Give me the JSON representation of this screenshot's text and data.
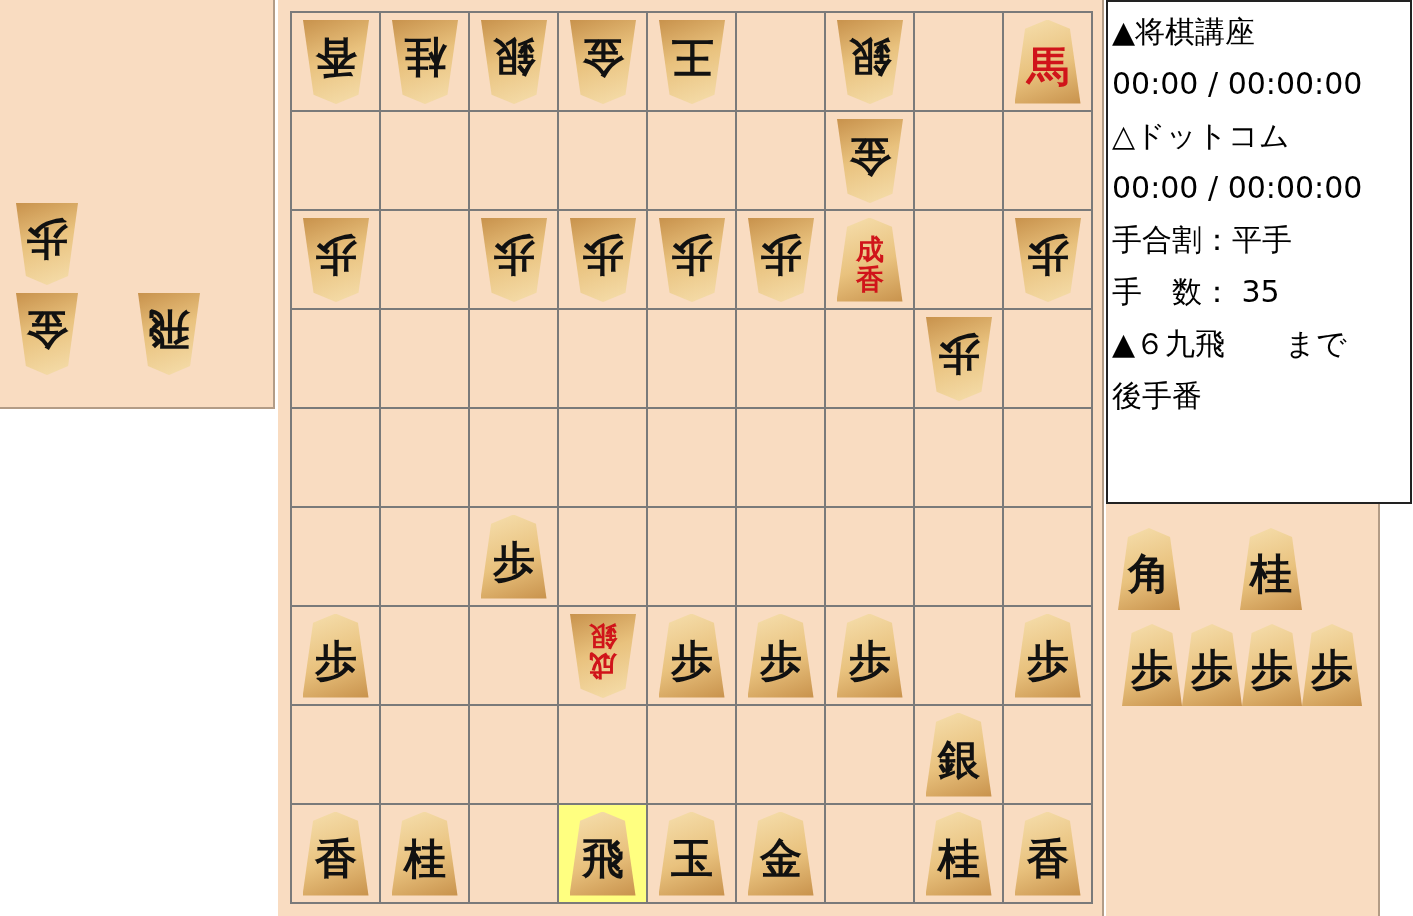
{
  "gote_hand": [
    [
      {
        "p": "歩"
      }
    ],
    [
      {
        "p": "金"
      },
      {
        "p": "飛"
      }
    ]
  ],
  "board": [
    [
      {
        "last_move": false,
        "piece": {
          "p": "香",
          "gote": true,
          "promoted": false
        }
      },
      {
        "last_move": false,
        "piece": {
          "p": "桂",
          "gote": true,
          "promoted": false
        }
      },
      {
        "last_move": false,
        "piece": {
          "p": "銀",
          "gote": true,
          "promoted": false
        }
      },
      {
        "last_move": false,
        "piece": {
          "p": "金",
          "gote": true,
          "promoted": false
        }
      },
      {
        "last_move": false,
        "piece": {
          "p": "王",
          "gote": true,
          "promoted": false
        }
      },
      {
        "last_move": false
      },
      {
        "last_move": false,
        "piece": {
          "p": "銀",
          "gote": true,
          "promoted": false
        }
      },
      {
        "last_move": false
      },
      {
        "last_move": false,
        "piece": {
          "p": "馬",
          "gote": false,
          "promoted": true
        }
      }
    ],
    [
      {
        "last_move": false
      },
      {
        "last_move": false
      },
      {
        "last_move": false
      },
      {
        "last_move": false
      },
      {
        "last_move": false
      },
      {
        "last_move": false
      },
      {
        "last_move": false,
        "piece": {
          "p": "金",
          "gote": true,
          "promoted": false
        }
      },
      {
        "last_move": false
      },
      {
        "last_move": false
      }
    ],
    [
      {
        "last_move": false,
        "piece": {
          "p": "歩",
          "gote": true,
          "promoted": false
        }
      },
      {
        "last_move": false
      },
      {
        "last_move": false,
        "piece": {
          "p": "歩",
          "gote": true,
          "promoted": false
        }
      },
      {
        "last_move": false,
        "piece": {
          "p": "歩",
          "gote": true,
          "promoted": false
        }
      },
      {
        "last_move": false,
        "piece": {
          "p": "歩",
          "gote": true,
          "promoted": false
        }
      },
      {
        "last_move": false,
        "piece": {
          "p": "歩",
          "gote": true,
          "promoted": false
        }
      },
      {
        "last_move": false,
        "piece": {
          "p": "成香",
          "gote": false,
          "promoted": true
        }
      },
      {
        "last_move": false
      },
      {
        "last_move": false,
        "piece": {
          "p": "歩",
          "gote": true,
          "promoted": false
        }
      }
    ],
    [
      {
        "last_move": false
      },
      {
        "last_move": false
      },
      {
        "last_move": false
      },
      {
        "last_move": false
      },
      {
        "last_move": false
      },
      {
        "last_move": false
      },
      {
        "last_move": false
      },
      {
        "last_move": false,
        "piece": {
          "p": "歩",
          "gote": true,
          "promoted": false
        }
      },
      {
        "last_move": false
      }
    ],
    [
      {
        "last_move": false
      },
      {
        "last_move": false
      },
      {
        "last_move": false
      },
      {
        "last_move": false
      },
      {
        "last_move": false
      },
      {
        "last_move": false
      },
      {
        "last_move": false
      },
      {
        "last_move": false
      },
      {
        "last_move": false
      }
    ],
    [
      {
        "last_move": false
      },
      {
        "last_move": false
      },
      {
        "last_move": false,
        "piece": {
          "p": "歩",
          "gote": false,
          "promoted": false
        }
      },
      {
        "last_move": false
      },
      {
        "last_move": false
      },
      {
        "last_move": false
      },
      {
        "last_move": false
      },
      {
        "last_move": false
      },
      {
        "last_move": false
      }
    ],
    [
      {
        "last_move": false,
        "piece": {
          "p": "歩",
          "gote": false,
          "promoted": false
        }
      },
      {
        "last_move": false
      },
      {
        "last_move": false
      },
      {
        "last_move": false,
        "piece": {
          "p": "成銀",
          "gote": true,
          "promoted": true
        }
      },
      {
        "last_move": false,
        "piece": {
          "p": "歩",
          "gote": false,
          "promoted": false
        }
      },
      {
        "last_move": false,
        "piece": {
          "p": "歩",
          "gote": false,
          "promoted": false
        }
      },
      {
        "last_move": false,
        "piece": {
          "p": "歩",
          "gote": false,
          "promoted": false
        }
      },
      {
        "last_move": false
      },
      {
        "last_move": false,
        "piece": {
          "p": "歩",
          "gote": false,
          "promoted": false
        }
      }
    ],
    [
      {
        "last_move": false
      },
      {
        "last_move": false
      },
      {
        "last_move": false
      },
      {
        "last_move": false
      },
      {
        "last_move": false
      },
      {
        "last_move": false
      },
      {
        "last_move": false
      },
      {
        "last_move": false,
        "piece": {
          "p": "銀",
          "gote": false,
          "promoted": false
        }
      },
      {
        "last_move": false
      }
    ],
    [
      {
        "last_move": false,
        "piece": {
          "p": "香",
          "gote": false,
          "promoted": false
        }
      },
      {
        "last_move": false,
        "piece": {
          "p": "桂",
          "gote": false,
          "promoted": false
        }
      },
      {
        "last_move": false
      },
      {
        "last_move": true,
        "piece": {
          "p": "飛",
          "gote": false,
          "promoted": false
        }
      },
      {
        "last_move": false,
        "piece": {
          "p": "玉",
          "gote": false,
          "promoted": false
        }
      },
      {
        "last_move": false,
        "piece": {
          "p": "金",
          "gote": false,
          "promoted": false
        }
      },
      {
        "last_move": false
      },
      {
        "last_move": false,
        "piece": {
          "p": "桂",
          "gote": false,
          "promoted": false
        }
      },
      {
        "last_move": false,
        "piece": {
          "p": "香",
          "gote": false,
          "promoted": false
        }
      }
    ]
  ],
  "info": [
    "▲将棋講座",
    "00:00 / 00:00:00",
    "△ドットコム",
    "00:00 / 00:00:00",
    "手合割：平手",
    "手　数：  35",
    "▲６九飛　　まで",
    "後手番"
  ],
  "sente_hand": [
    [
      {
        "p": "角"
      },
      {
        "p": "桂"
      }
    ],
    [
      {
        "p": "歩"
      },
      {
        "p": "歩"
      },
      {
        "p": "歩"
      },
      {
        "p": "歩"
      }
    ]
  ]
}
